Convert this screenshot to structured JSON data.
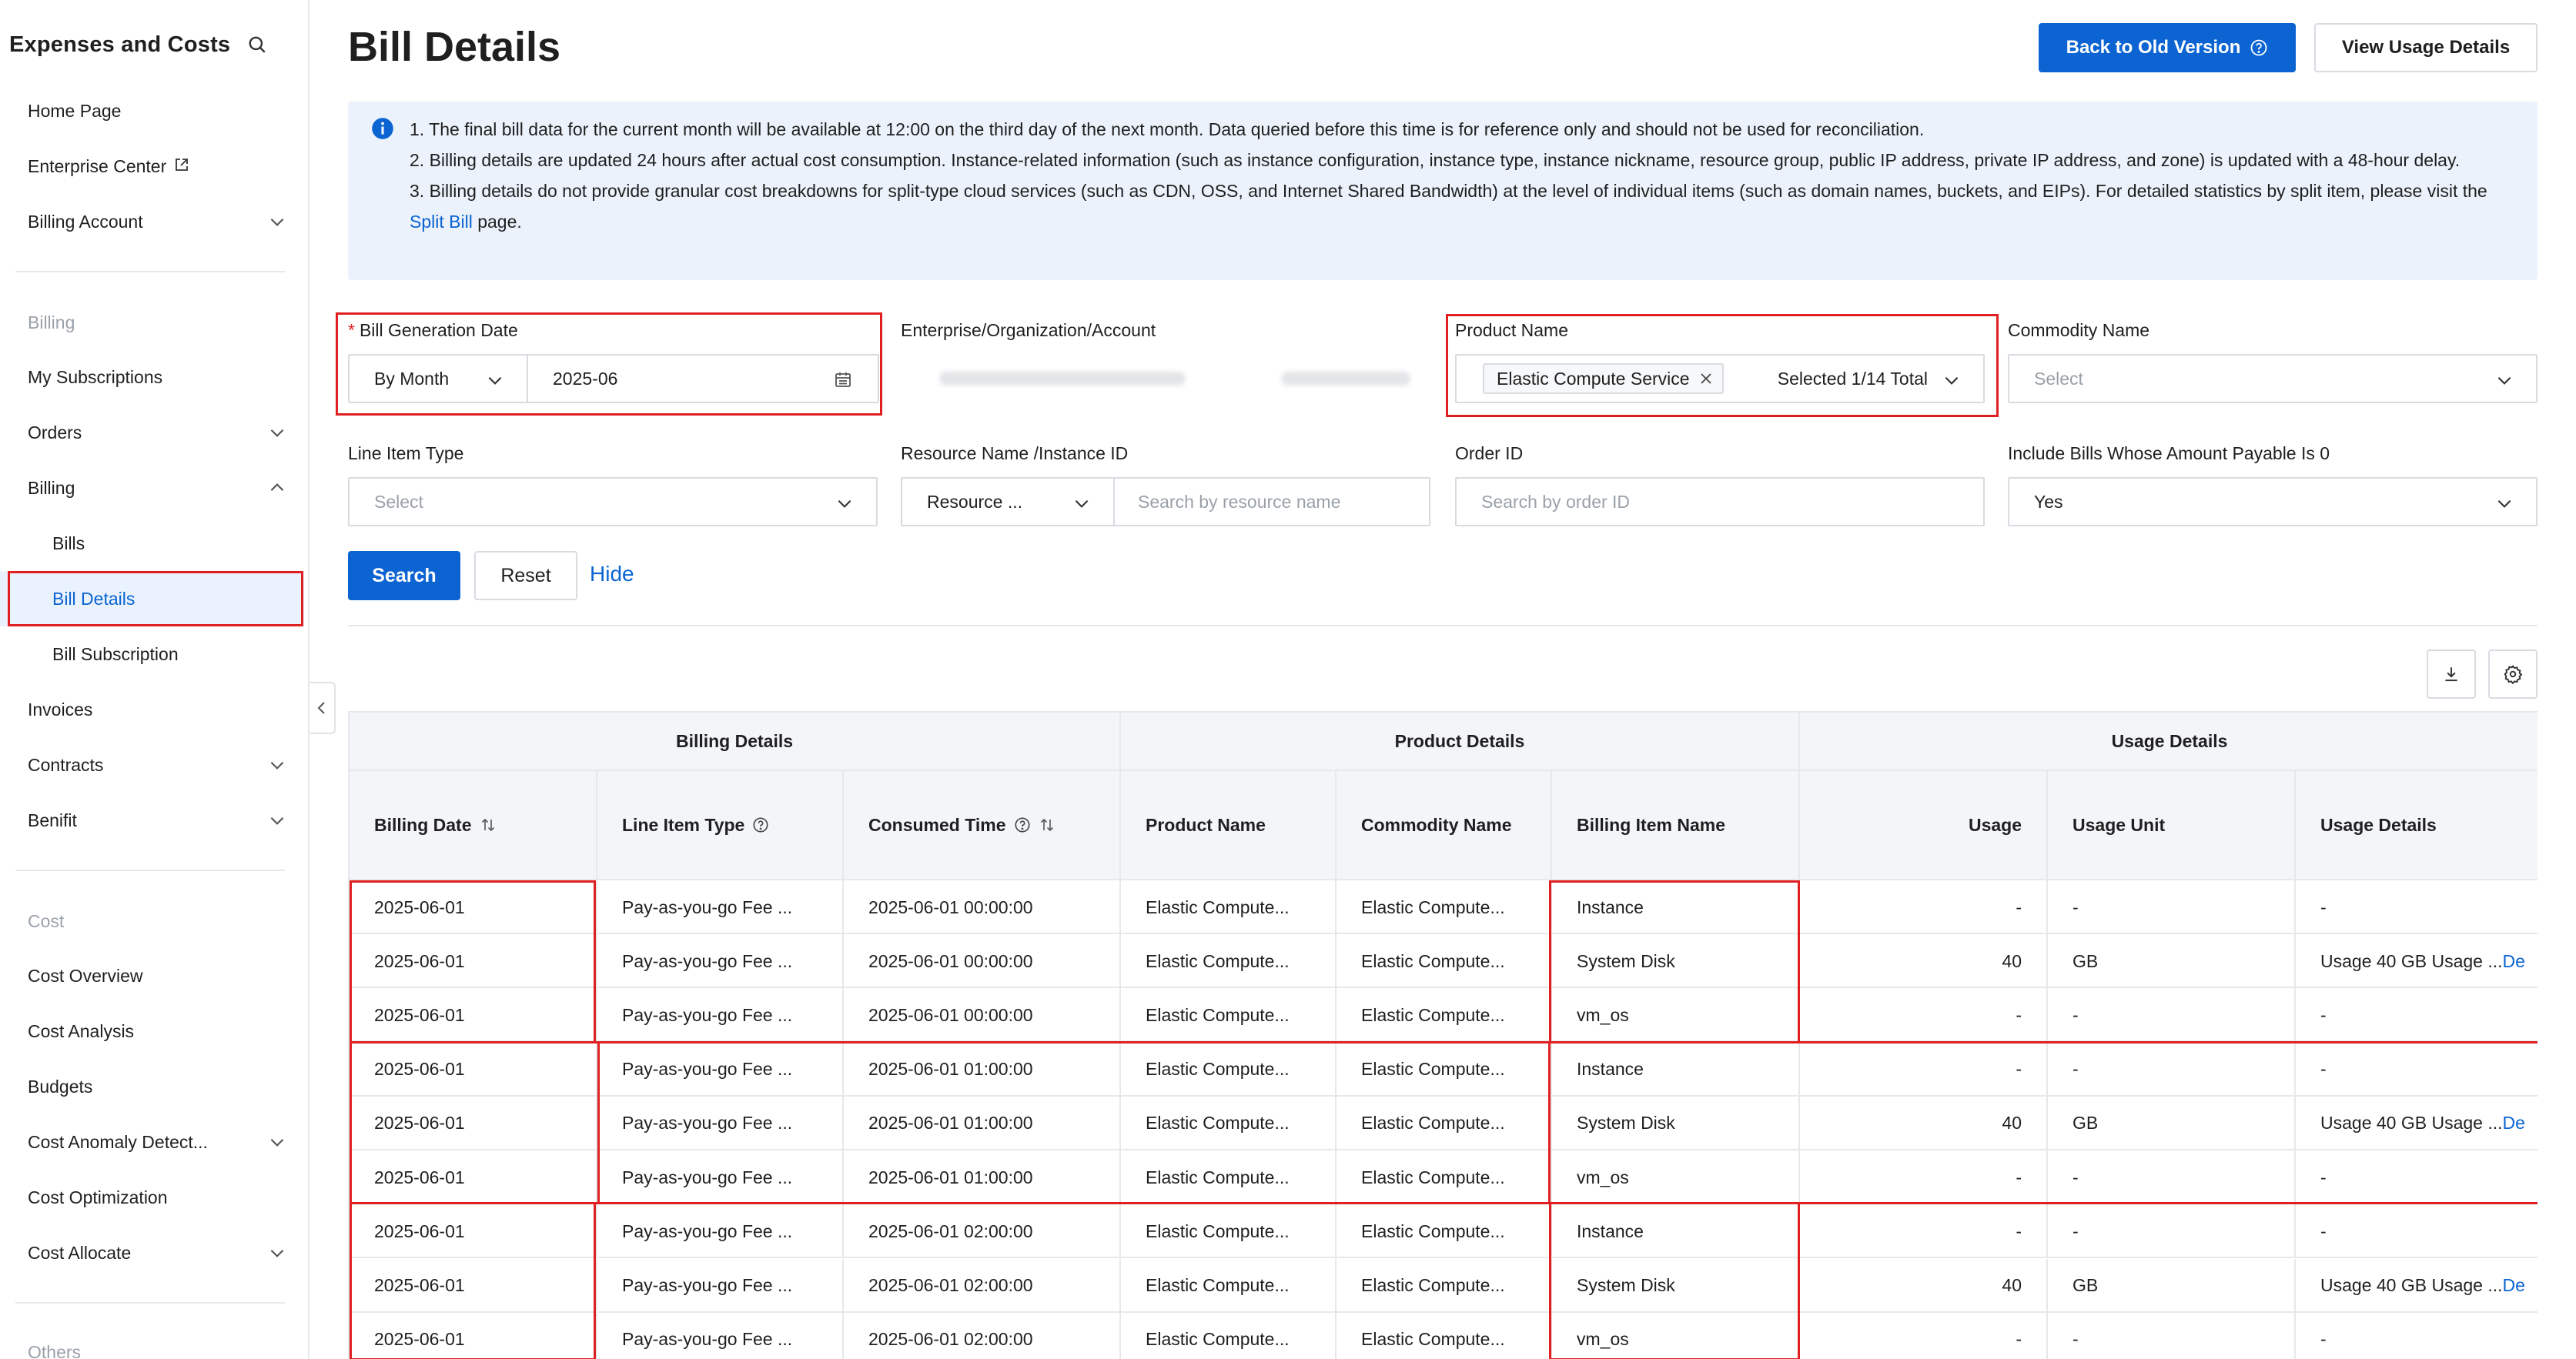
{
  "sidebar": {
    "title": "Expenses and Costs",
    "items_top": [
      {
        "label": "Home Page"
      },
      {
        "label": "Enterprise Center",
        "external": true
      },
      {
        "label": "Billing Account",
        "chevron": "down"
      }
    ],
    "group_billing": "Billing",
    "items_billing": [
      {
        "label": "My Subscriptions"
      },
      {
        "label": "Orders",
        "chevron": "down"
      },
      {
        "label": "Billing",
        "chevron": "up"
      },
      {
        "label": "Bills",
        "sub": true
      },
      {
        "label": "Bill Details",
        "sub": true,
        "active": true
      },
      {
        "label": "Bill Subscription",
        "sub": true
      },
      {
        "label": "Invoices"
      },
      {
        "label": "Contracts",
        "chevron": "down"
      },
      {
        "label": "Benifit",
        "chevron": "down"
      }
    ],
    "group_cost": "Cost",
    "items_cost": [
      {
        "label": "Cost Overview"
      },
      {
        "label": "Cost Analysis"
      },
      {
        "label": "Budgets"
      },
      {
        "label": "Cost Anomaly Detect...",
        "chevron": "down"
      },
      {
        "label": "Cost Optimization"
      },
      {
        "label": "Cost Allocate",
        "chevron": "down"
      }
    ],
    "group_others": "Others"
  },
  "header": {
    "title": "Bill Details",
    "back_old": "Back to Old Version",
    "view_usage": "View Usage Details"
  },
  "notice": {
    "line1": "1. The final bill data for the current month will be available at 12:00 on the third day of the next month. Data queried before this time is for reference only and should not be used for reconciliation.",
    "line2": "2. Billing details are updated 24 hours after actual cost consumption. Instance-related information (such as instance configuration, instance type, instance nickname, resource group, public IP address, private IP address, and zone) is updated with a 48-hour delay.",
    "line3a": "3. Billing details do not provide granular cost breakdowns for split-type cloud services (such as CDN, OSS, and Internet Shared Bandwidth) at the level of individual items (such as domain names, buckets, and EIPs). For detailed statistics by split item, please visit the ",
    "line3link": "Split Bill",
    "line3b": " page."
  },
  "filters": {
    "bill_date": {
      "label": "Bill Generation Date",
      "period": "By Month",
      "value": "2025-06"
    },
    "account": {
      "label": "Enterprise/Organization/Account"
    },
    "product": {
      "label": "Product Name",
      "tag": "Elastic Compute Service",
      "summary": "Selected 1/14 Total"
    },
    "commodity": {
      "label": "Commodity Name",
      "placeholder": "Select"
    },
    "line_item": {
      "label": "Line Item Type",
      "placeholder": "Select"
    },
    "resource": {
      "label": "Resource Name /Instance ID",
      "type": "Resource ...",
      "placeholder": "Search by resource name"
    },
    "order": {
      "label": "Order ID",
      "placeholder": "Search by order ID"
    },
    "include_zero": {
      "label": "Include Bills Whose Amount Payable Is 0",
      "value": "Yes"
    }
  },
  "actions": {
    "search": "Search",
    "reset": "Reset",
    "hide": "Hide"
  },
  "table": {
    "groups": [
      "Billing Details",
      "Product Details",
      "Usage Details"
    ],
    "columns": [
      "Billing Date",
      "Line Item Type",
      "Consumed Time",
      "Product Name",
      "Commodity Name",
      "Billing Item Name",
      "Usage",
      "Usage Unit",
      "Usage Details"
    ],
    "rows": [
      [
        "2025-06-01",
        "Pay-as-you-go Fee ...",
        "2025-06-01 00:00:00",
        "Elastic Compute...",
        "Elastic Compute...",
        "Instance",
        "-",
        "-",
        "-",
        ""
      ],
      [
        "2025-06-01",
        "Pay-as-you-go Fee ...",
        "2025-06-01 00:00:00",
        "Elastic Compute...",
        "Elastic Compute...",
        "System Disk",
        "40",
        "GB",
        "Usage 40 GB Usage ...",
        "De"
      ],
      [
        "2025-06-01",
        "Pay-as-you-go Fee ...",
        "2025-06-01 00:00:00",
        "Elastic Compute...",
        "Elastic Compute...",
        "vm_os",
        "-",
        "-",
        "-",
        ""
      ],
      [
        "2025-06-01",
        "Pay-as-you-go Fee ...",
        "2025-06-01 01:00:00",
        "Elastic Compute...",
        "Elastic Compute...",
        "Instance",
        "-",
        "-",
        "-",
        ""
      ],
      [
        "2025-06-01",
        "Pay-as-you-go Fee ...",
        "2025-06-01 01:00:00",
        "Elastic Compute...",
        "Elastic Compute...",
        "System Disk",
        "40",
        "GB",
        "Usage 40 GB Usage ...",
        "De"
      ],
      [
        "2025-06-01",
        "Pay-as-you-go Fee ...",
        "2025-06-01 01:00:00",
        "Elastic Compute...",
        "Elastic Compute...",
        "vm_os",
        "-",
        "-",
        "-",
        ""
      ],
      [
        "2025-06-01",
        "Pay-as-you-go Fee ...",
        "2025-06-01 02:00:00",
        "Elastic Compute...",
        "Elastic Compute...",
        "Instance",
        "-",
        "-",
        "-",
        ""
      ],
      [
        "2025-06-01",
        "Pay-as-you-go Fee ...",
        "2025-06-01 02:00:00",
        "Elastic Compute...",
        "Elastic Compute...",
        "System Disk",
        "40",
        "GB",
        "Usage 40 GB Usage ...",
        "De"
      ],
      [
        "2025-06-01",
        "Pay-as-you-go Fee ...",
        "2025-06-01 02:00:00",
        "Elastic Compute...",
        "Elastic Compute...",
        "vm_os",
        "-",
        "-",
        "-",
        ""
      ]
    ]
  },
  "colors": {
    "accent": "#0b64d1",
    "highlight": "#e02020",
    "notice_bg": "#ebf2fb"
  }
}
